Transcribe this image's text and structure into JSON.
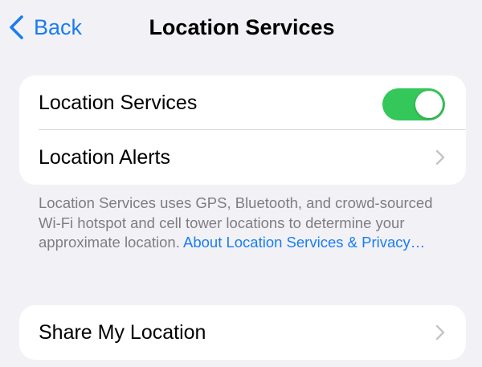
{
  "nav": {
    "back_label": "Back",
    "title": "Location Services"
  },
  "group1": {
    "location_services": {
      "label": "Location Services",
      "toggle_on": true,
      "toggle_color": "#34c759"
    },
    "location_alerts": {
      "label": "Location Alerts"
    }
  },
  "footer": {
    "text": "Location Services uses GPS, Bluetooth, and crowd-sourced Wi-Fi hotspot and cell tower locations to determine your approximate location.",
    "link": "About Location Services & Privacy…"
  },
  "group2": {
    "share_my_location": {
      "label": "Share My Location"
    }
  },
  "colors": {
    "accent": "#1a7cf2",
    "background": "#f2f2f6",
    "secondary_text": "#7d7d82"
  }
}
